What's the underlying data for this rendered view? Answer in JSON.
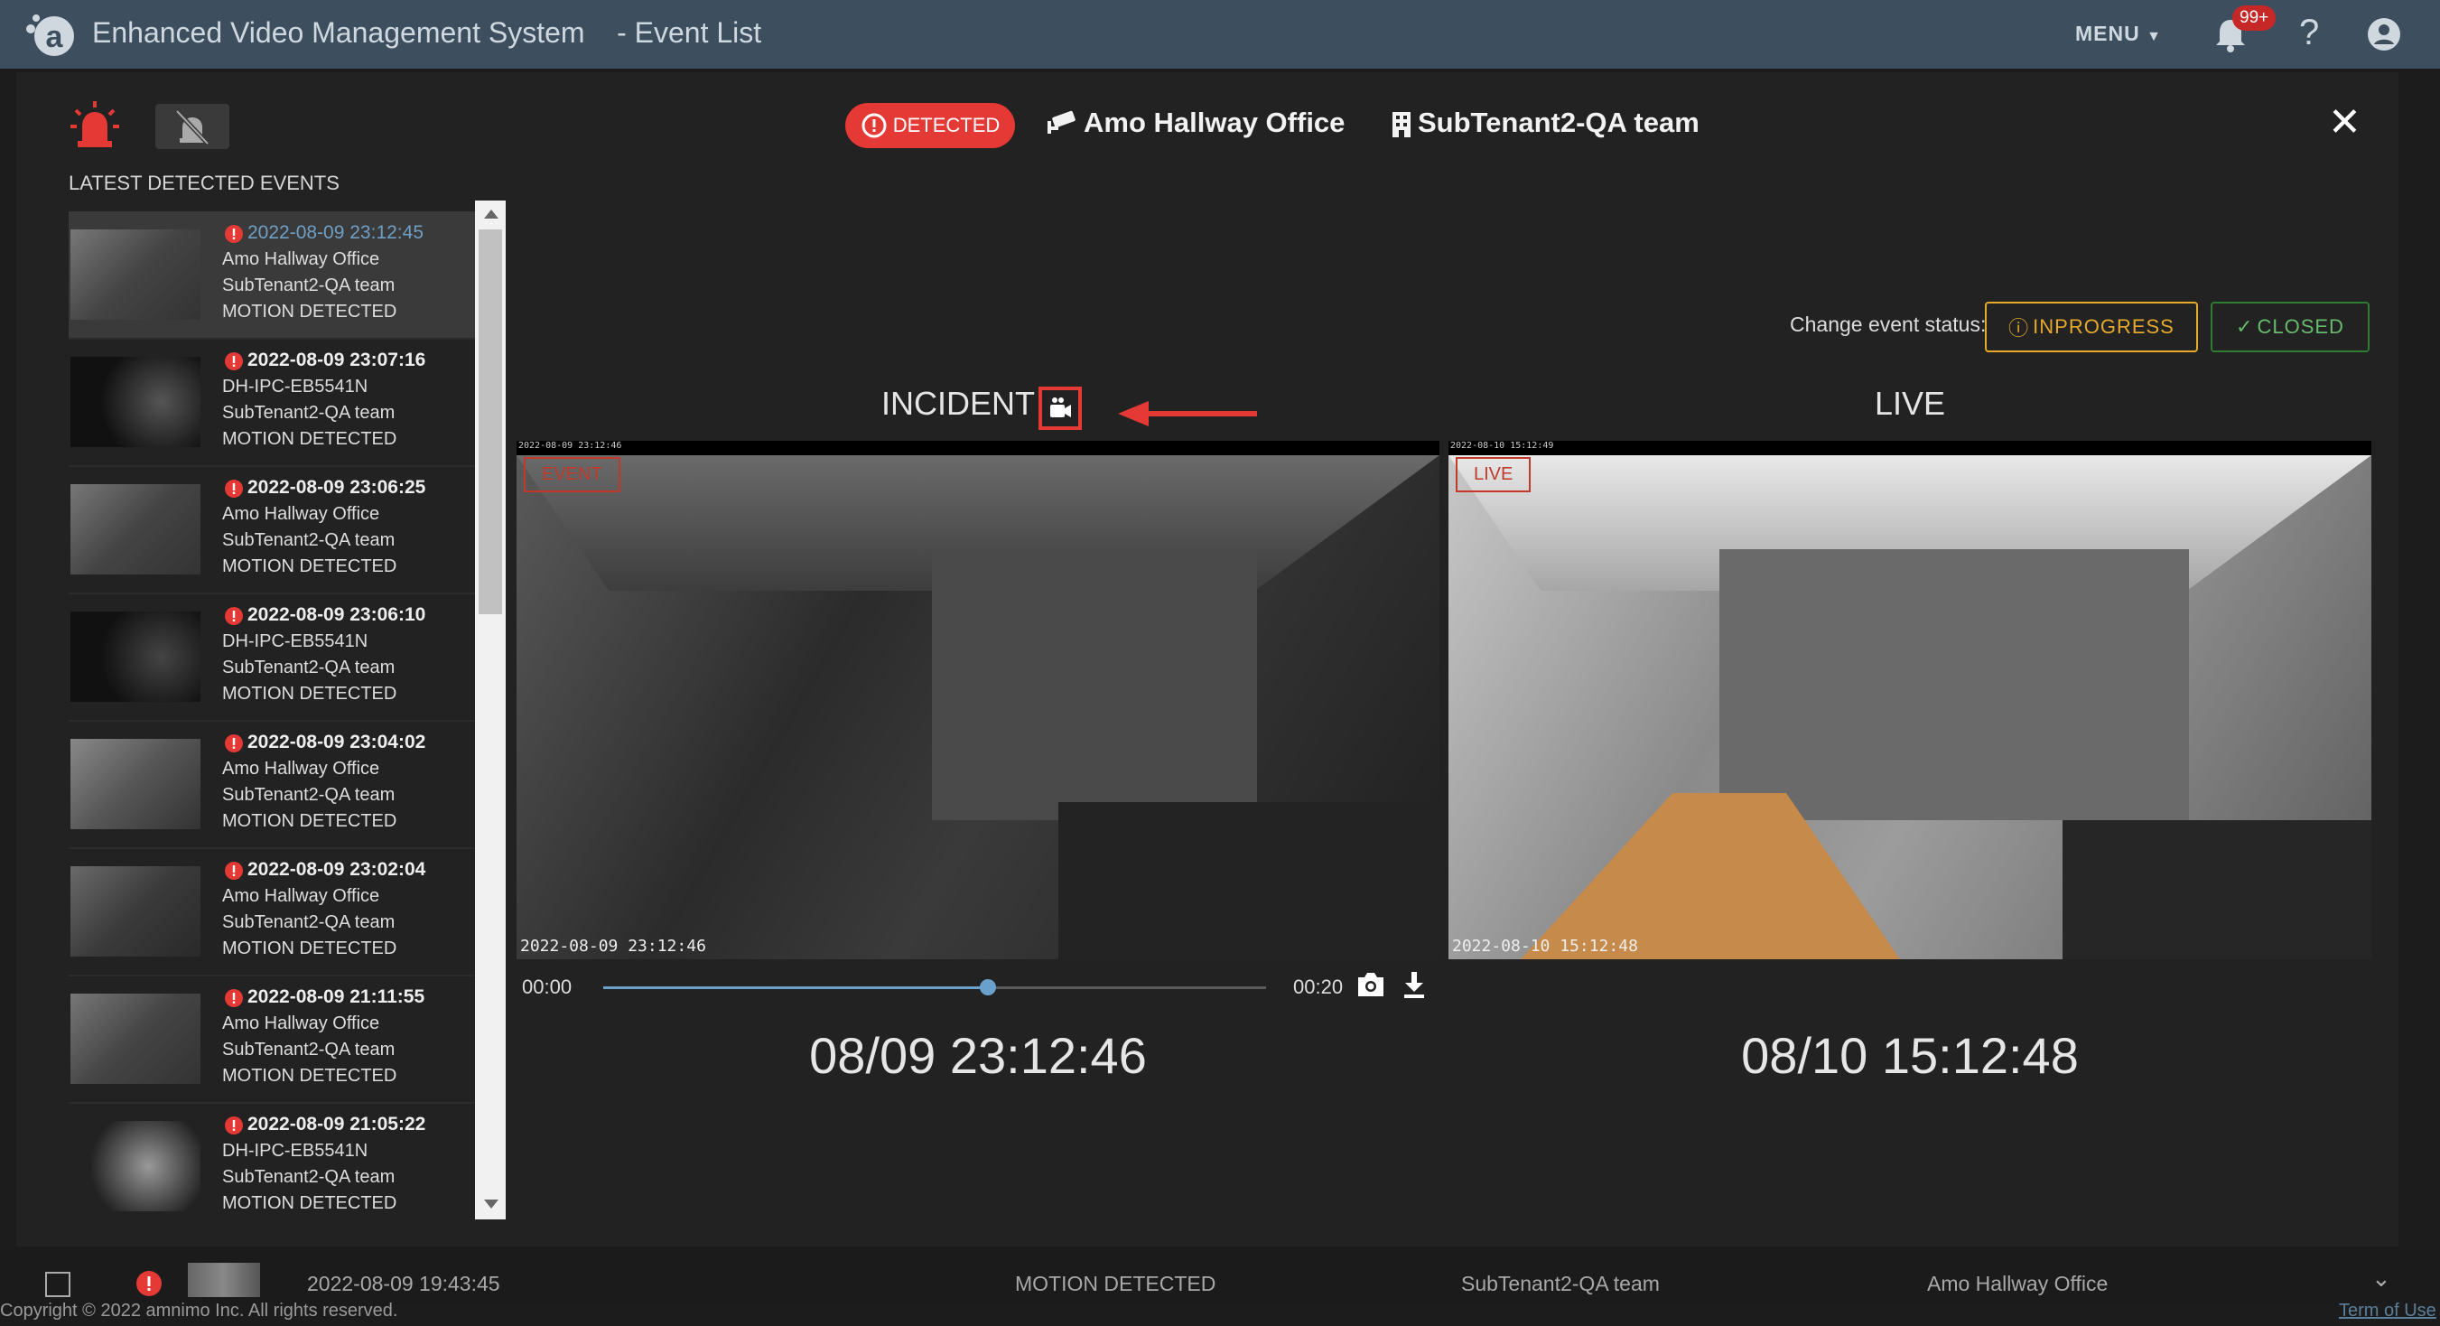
{
  "app": {
    "title": "Enhanced Video Management System",
    "page": "- Event List",
    "menu_label": "MENU",
    "notification_count": "99+",
    "help_label": "?"
  },
  "modal": {
    "latest_title": "LATEST DETECTED EVENTS",
    "detected_label": "DETECTED",
    "camera_name": "Amo Hallway Office",
    "tenant_name": "SubTenant2-QA team",
    "close_label": "✕",
    "status_label": "Change event status:",
    "inprogress_label": "INPROGRESS",
    "closed_label": "CLOSED",
    "incident_title": "INCIDENT",
    "live_title": "LIVE",
    "event_tag": "EVENT",
    "live_tag": "LIVE",
    "event_overlay_small": "2022-08-09 23:12:46",
    "event_overlay_big": "2022-08-09 23:12:46",
    "live_overlay_small": "2022-08-10 15:12:49",
    "live_overlay_big": "2022-08-10 15:12:48",
    "time_start": "00:00",
    "time_end": "00:20",
    "progress_fraction": 0.58,
    "event_clock": "08/09 23:12:46",
    "live_clock": "08/10 15:12:48"
  },
  "events": [
    {
      "time": "2022-08-09 23:12:45",
      "camera": "Amo Hallway Office",
      "tenant": "SubTenant2-QA team",
      "type": "MOTION DETECTED",
      "selected": true
    },
    {
      "time": "2022-08-09 23:07:16",
      "camera": "DH-IPC-EB5541N",
      "tenant": "SubTenant2-QA team",
      "type": "MOTION DETECTED"
    },
    {
      "time": "2022-08-09 23:06:25",
      "camera": "Amo Hallway Office",
      "tenant": "SubTenant2-QA team",
      "type": "MOTION DETECTED"
    },
    {
      "time": "2022-08-09 23:06:10",
      "camera": "DH-IPC-EB5541N",
      "tenant": "SubTenant2-QA team",
      "type": "MOTION DETECTED"
    },
    {
      "time": "2022-08-09 23:04:02",
      "camera": "Amo Hallway Office",
      "tenant": "SubTenant2-QA team",
      "type": "MOTION DETECTED"
    },
    {
      "time": "2022-08-09 23:02:04",
      "camera": "Amo Hallway Office",
      "tenant": "SubTenant2-QA team",
      "type": "MOTION DETECTED"
    },
    {
      "time": "2022-08-09 21:11:55",
      "camera": "Amo Hallway Office",
      "tenant": "SubTenant2-QA team",
      "type": "MOTION DETECTED"
    },
    {
      "time": "2022-08-09 21:05:22",
      "camera": "DH-IPC-EB5541N",
      "tenant": "SubTenant2-QA team",
      "type": "MOTION DETECTED"
    }
  ],
  "background_row": {
    "time": "2022-08-09 19:43:45",
    "type": "MOTION DETECTED",
    "tenant": "SubTenant2-QA team",
    "camera": "Amo Hallway Office"
  },
  "footer": {
    "copyright": "Copyright © 2022 amnimo Inc. All rights reserved.",
    "terms": "Term of Use"
  },
  "colors": {
    "topbar": "#3d4f5f",
    "alert_red": "#e53935",
    "inprogress": "#e6a92b",
    "closed": "#66bb6a",
    "link_blue": "#6f9fc4"
  }
}
